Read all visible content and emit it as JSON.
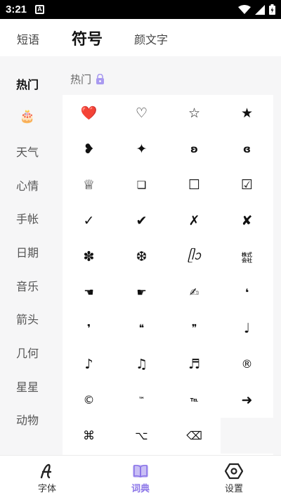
{
  "status_bar": {
    "time": "3:21",
    "notification": "A"
  },
  "top_tabs": [
    {
      "label": "短语",
      "active": false
    },
    {
      "label": "符号",
      "active": true
    },
    {
      "label": "颜文字",
      "active": false
    }
  ],
  "sidebar": {
    "items": [
      {
        "label": "热门",
        "active": true
      },
      {
        "label": "🎂",
        "active": false
      },
      {
        "label": "天气",
        "active": false
      },
      {
        "label": "心情",
        "active": false
      },
      {
        "label": "手帐",
        "active": false
      },
      {
        "label": "日期",
        "active": false
      },
      {
        "label": "音乐",
        "active": false
      },
      {
        "label": "箭头",
        "active": false
      },
      {
        "label": "几何",
        "active": false
      },
      {
        "label": "星星",
        "active": false
      },
      {
        "label": "动物",
        "active": false
      }
    ]
  },
  "section": {
    "title": "热门",
    "lock_icon": "lock-icon"
  },
  "symbols": [
    "❤️",
    "♡",
    "☆",
    "★",
    "❥",
    "✦",
    "ʚ",
    "ɞ",
    "♕",
    "❏",
    "☐",
    "☑",
    "✓",
    "✔",
    "✗",
    "✘",
    "✽",
    "❆",
    "ᥫᩣ",
    "㍿",
    "☚",
    "☛",
    "✍",
    "❛",
    "❜",
    "❝",
    "❞",
    "♩",
    "♪",
    "♫",
    "♬",
    "®",
    "©",
    "™",
    "℡",
    "➜",
    "⌘",
    "⌥",
    "⌫",
    ""
  ],
  "bottom_nav": [
    {
      "label": "字体",
      "icon": "font-icon",
      "active": false
    },
    {
      "label": "词典",
      "icon": "book-icon",
      "active": true
    },
    {
      "label": "设置",
      "icon": "settings-hexagon-icon",
      "active": false
    }
  ],
  "colors": {
    "accent": "#8b75e8",
    "accent_light": "#c9bff5",
    "heart": "#e8282b",
    "background": "#f6f6f7"
  }
}
